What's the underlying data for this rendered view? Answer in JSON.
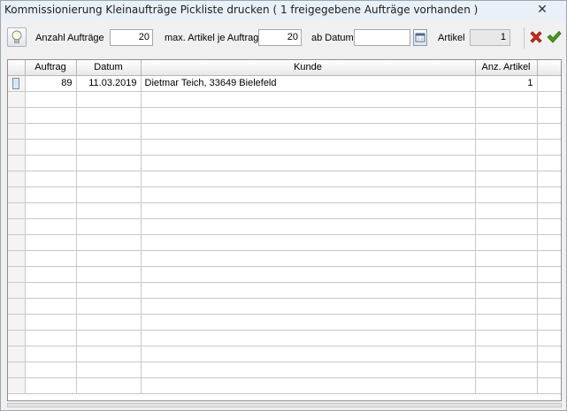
{
  "window": {
    "title": "Kommissionierung Kleinaufträge Pickliste drucken ( 1 freigegebene Aufträge vorhanden )",
    "close_glyph": "✕"
  },
  "toolbar": {
    "hint_icon": "lightbulb-icon",
    "anzahl_label": "Anzahl Aufträge",
    "anzahl_value": "20",
    "max_label": "max. Artikel je Auftrag",
    "max_value": "20",
    "datum_label": "ab Datum",
    "datum_value": "",
    "calendar_icon": "calendar-icon",
    "artikel_label": "Artikel",
    "artikel_value": "1",
    "cancel_icon": "red-x-icon",
    "ok_icon": "green-check-icon"
  },
  "grid": {
    "columns": [
      "Auftrag",
      "Datum",
      "Kunde",
      "Anz. Artikel"
    ],
    "rows": [
      {
        "auftrag": "89",
        "datum": "11.03.2019",
        "kunde": "Dietmar Teich, 33649 Bielefeld",
        "anzahl": "1"
      }
    ]
  },
  "colors": {
    "window_bg": "#f0f0f0",
    "title_bar": "#e9f0f8",
    "cancel_red": "#d42a1c",
    "ok_green": "#4a9a1c"
  }
}
